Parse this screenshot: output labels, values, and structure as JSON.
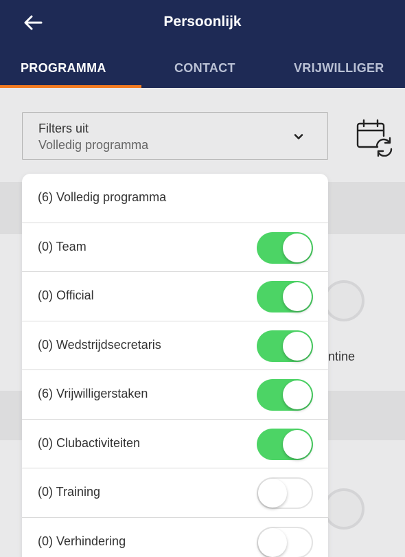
{
  "header": {
    "title": "Persoonlijk",
    "back_icon": "arrow-left-icon"
  },
  "tabs": [
    {
      "label": "PROGRAMMA",
      "active": true
    },
    {
      "label": "CONTACT",
      "active": false
    },
    {
      "label": "VRIJWILLIGER",
      "active": false
    }
  ],
  "filter": {
    "title": "Filters uit",
    "selected": "Volledig programma",
    "chevron_icon": "chevron-down-icon"
  },
  "calendar_button": {
    "icon": "calendar-refresh-icon"
  },
  "background": {
    "partial_text": "ntine"
  },
  "popover": {
    "items": [
      {
        "label": "(6) Volledig programma",
        "has_toggle": false
      },
      {
        "label": "(0) Team",
        "has_toggle": true,
        "on": true
      },
      {
        "label": "(0) Official",
        "has_toggle": true,
        "on": true
      },
      {
        "label": "(0) Wedstrijdsecretaris",
        "has_toggle": true,
        "on": true
      },
      {
        "label": "(6) Vrijwilligerstaken",
        "has_toggle": true,
        "on": true
      },
      {
        "label": "(0) Clubactiviteiten",
        "has_toggle": true,
        "on": true
      },
      {
        "label": "(0) Training",
        "has_toggle": true,
        "on": false
      },
      {
        "label": "(0) Verhindering",
        "has_toggle": true,
        "on": false
      }
    ]
  },
  "colors": {
    "header_bg": "#1e2a55",
    "tab_indicator": "#f47b20",
    "toggle_on": "#4cd465"
  }
}
